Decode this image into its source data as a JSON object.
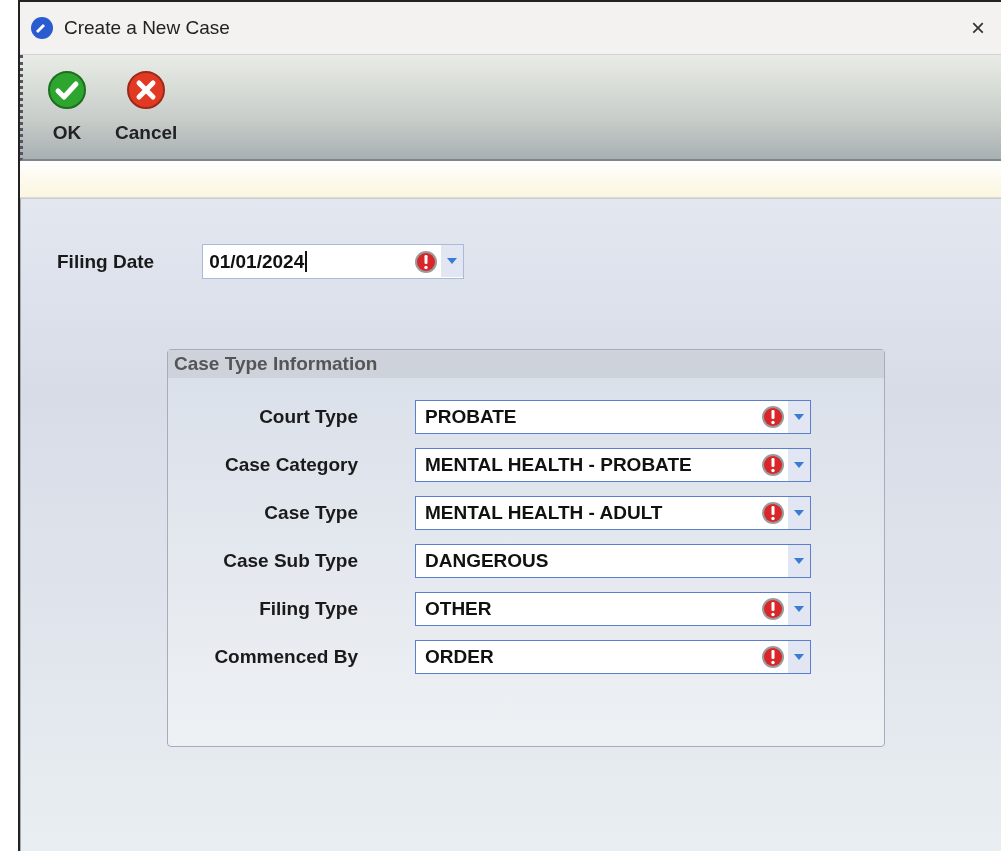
{
  "window": {
    "title": "Create a New Case",
    "close": "×"
  },
  "toolbar": [
    {
      "kind": "ok",
      "label": "OK"
    },
    {
      "kind": "cancel",
      "label": "Cancel"
    }
  ],
  "filing_date": {
    "label": "Filing Date",
    "value": "01/01/2024",
    "required": true
  },
  "case_type_information": {
    "title": "Case Type Information",
    "fields": [
      {
        "label": "Court Type",
        "value": "PROBATE",
        "required": true
      },
      {
        "label": "Case Category",
        "value": "MENTAL HEALTH - PROBATE",
        "required": true
      },
      {
        "label": "Case Type",
        "value": "MENTAL HEALTH - ADULT",
        "required": true
      },
      {
        "label": "Case Sub Type",
        "value": "DANGEROUS",
        "required": false
      },
      {
        "label": "Filing Type",
        "value": "OTHER",
        "required": true
      },
      {
        "label": "Commenced By",
        "value": "ORDER",
        "required": true
      }
    ]
  }
}
